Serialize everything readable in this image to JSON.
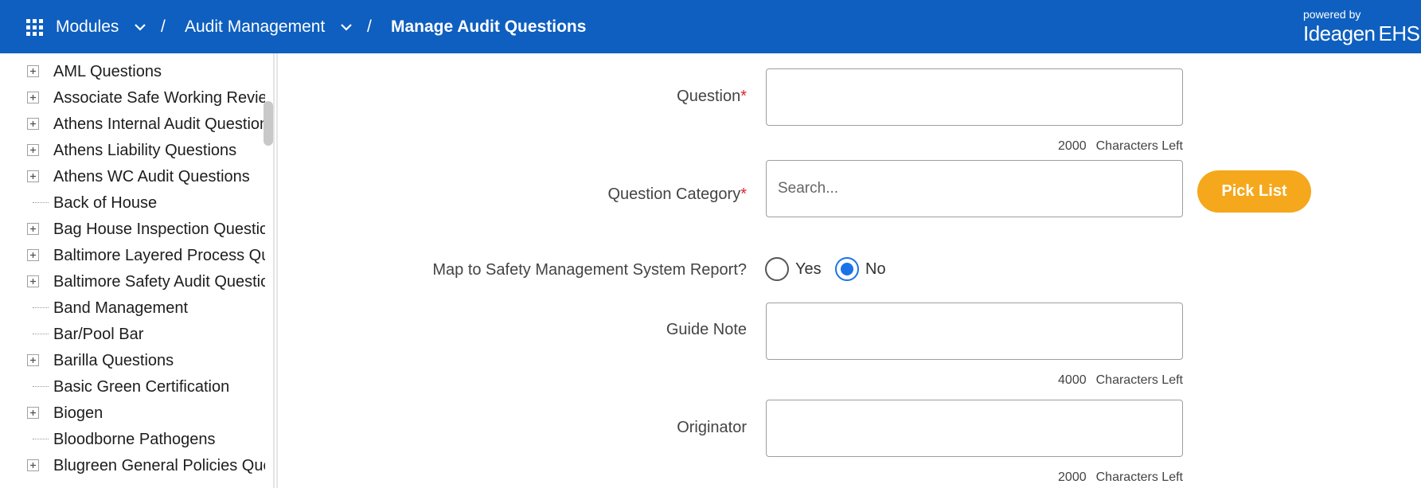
{
  "header": {
    "breadcrumb": [
      {
        "label": "Modules",
        "has_dropdown": true
      },
      {
        "label": "Audit Management",
        "has_dropdown": true
      },
      {
        "label": "Manage Audit Questions",
        "has_dropdown": false
      }
    ],
    "separator": "/",
    "brand": {
      "powered_by": "powered by",
      "logo_name": "Ideagen",
      "logo_suffix": "EHS"
    },
    "colors": {
      "bar": "#0e5fbf"
    }
  },
  "tree": {
    "items": [
      {
        "label": "AML Questions",
        "expandable": true
      },
      {
        "label": "Associate Safe Working Review",
        "expandable": true
      },
      {
        "label": "Athens Internal Audit Questions",
        "expandable": true
      },
      {
        "label": "Athens Liability Questions",
        "expandable": true
      },
      {
        "label": "Athens WC Audit Questions",
        "expandable": true
      },
      {
        "label": "Back of House",
        "expandable": false
      },
      {
        "label": "Bag House Inspection Questions",
        "expandable": true
      },
      {
        "label": "Baltimore Layered Process Questions",
        "expandable": true
      },
      {
        "label": "Baltimore Safety Audit Questions",
        "expandable": true
      },
      {
        "label": "Band Management",
        "expandable": false
      },
      {
        "label": "Bar/Pool Bar",
        "expandable": false
      },
      {
        "label": "Barilla Questions",
        "expandable": true
      },
      {
        "label": "Basic Green Certification",
        "expandable": false
      },
      {
        "label": "Biogen",
        "expandable": true
      },
      {
        "label": "Bloodborne Pathogens",
        "expandable": false
      },
      {
        "label": "Blugreen General Policies Questions",
        "expandable": true
      }
    ]
  },
  "form": {
    "question": {
      "label": "Question",
      "required_mark": "*",
      "value": "",
      "chars_left": "2000",
      "chars_left_label": "Characters Left"
    },
    "category": {
      "label": "Question Category",
      "required_mark": "*",
      "placeholder": "Search...",
      "picklist_label": "Pick List"
    },
    "map_sms": {
      "label": "Map to Safety Management System Report?",
      "options": [
        "Yes",
        "No"
      ],
      "selected": "No"
    },
    "guide_note": {
      "label": "Guide Note",
      "value": "",
      "chars_left": "4000",
      "chars_left_label": "Characters Left"
    },
    "originator": {
      "label": "Originator",
      "value": "",
      "chars_left": "2000",
      "chars_left_label": "Characters Left"
    },
    "colors": {
      "accent": "#f5a81b",
      "radio_selected": "#1a73e8",
      "required": "#d9232e"
    }
  }
}
